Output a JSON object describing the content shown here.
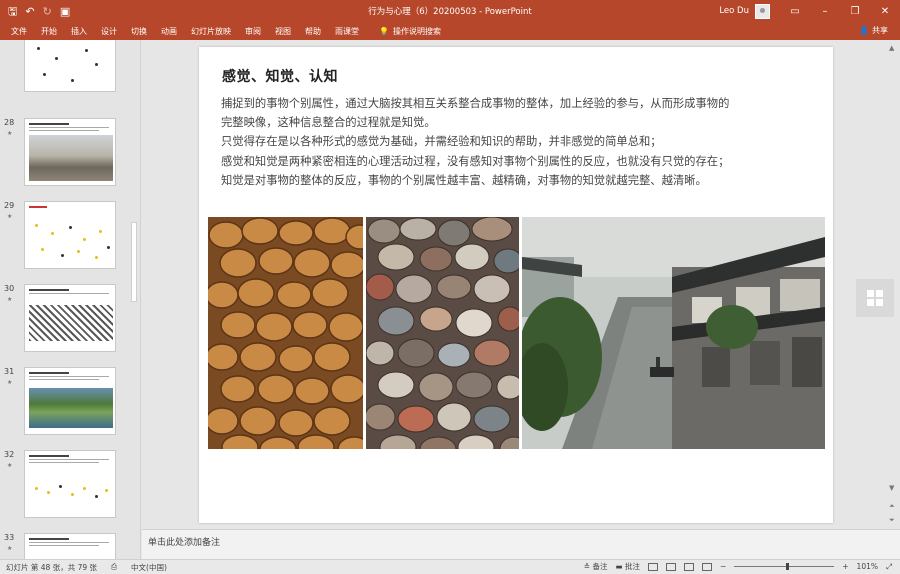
{
  "titlebar": {
    "title": "行为与心理（6）20200503  -  PowerPoint",
    "user": "Leo Du",
    "qat": {
      "save_icon": "save-icon",
      "undo_icon": "undo-icon",
      "redo_icon": "redo-icon",
      "present_icon": "present-icon"
    },
    "controls": {
      "restore_ribbon": "ribbon-display-icon",
      "minimize": "–",
      "maximize": "❐",
      "close": "✕"
    }
  },
  "ribbon": {
    "tabs": [
      "文件",
      "开始",
      "插入",
      "设计",
      "切换",
      "动画",
      "幻灯片放映",
      "审阅",
      "视图",
      "帮助",
      "雨课堂"
    ],
    "tell_me": "操作说明搜索",
    "share": "共享"
  },
  "thumbnails": [
    {
      "number": "",
      "kind": "dots"
    },
    {
      "number": "28",
      "kind": "city"
    },
    {
      "number": "29",
      "kind": "yellow-dots"
    },
    {
      "number": "30",
      "kind": "pattern"
    },
    {
      "number": "31",
      "kind": "aerial"
    },
    {
      "number": "32",
      "kind": "line-dots"
    },
    {
      "number": "33",
      "kind": "text"
    }
  ],
  "slide": {
    "title": "感觉、知觉、认知",
    "paragraphs": [
      "捕捉到的事物个别属性，通过大脑按其相互关系整合成事物的整体，加上经验的参与，从而形成事物的",
      "完整映像，这种信息整合的过程就是知觉。",
      "只觉得存在是以各种形式的感觉为基础，并需经验和知识的帮助，并非感觉的简单总和；",
      "感觉和知觉是两种紧密相连的心理活动过程，没有感知对事物个别属性的反应，也就没有只觉的存在；",
      "知觉是对事物的整体的反应，事物的个别属性越丰富、越精确，对事物的知觉就越完整、越清晰。"
    ],
    "images": [
      "pastries-photo",
      "pebbles-photo",
      "water-town-photo"
    ]
  },
  "notes": {
    "placeholder": "单击此处添加备注"
  },
  "status": {
    "slide_info": "幻灯片 第 48 张，共 79 张",
    "language": "中文(中国)",
    "notes_btn": "备注",
    "comments_btn": "批注",
    "zoom": "101%",
    "zoom_fraction": 0.52
  }
}
